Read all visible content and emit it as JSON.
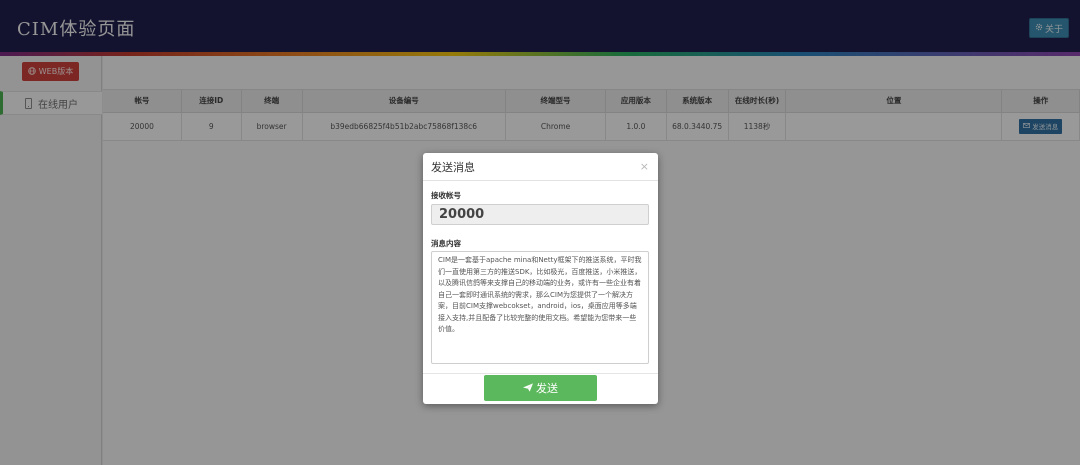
{
  "header": {
    "title": "CIM体验页面",
    "about_label": "关于",
    "about_icon": "gear-icon"
  },
  "sidebar": {
    "web_button": {
      "label": "WEB版本",
      "icon": "globe-icon"
    },
    "items": [
      {
        "label": "在线用户",
        "icon": "phone-icon",
        "active": true
      }
    ]
  },
  "table": {
    "columns": [
      "帐号",
      "连接ID",
      "终端",
      "设备编号",
      "终端型号",
      "应用版本",
      "系统版本",
      "在线时长(秒)",
      "位置",
      "操作"
    ],
    "rows": [
      {
        "account": "20000",
        "conn_id": "9",
        "terminal": "browser",
        "device_id": "b39edb66825f4b51b2abc75868f138c6",
        "model": "Chrome",
        "app_version": "1.0.0",
        "os_version": "68.0.3440.75",
        "online": "1138秒",
        "location": "",
        "action": "发送消息"
      }
    ]
  },
  "modal": {
    "title": "发送消息",
    "close": "×",
    "account_label": "接收帐号",
    "account_value": "20000",
    "message_label": "消息内容",
    "message_value": "CIM是一套基于apache mina和Netty框架下的推送系统，平时我们一直使用第三方的推送SDK，比如极光，百度推送，小米推送，以及腾讯信鸽等来支撑自己的移动端的业务，或许有一些企业有着自己一套即时通讯系统的需求，那么CIM为您提供了一个解决方案，目前CIM支撑webcokset，android，ios，桌面应用等多端接入支持,并且配备了比较完整的使用文档。希望能为您带来一些价值。",
    "send_label": "发送"
  },
  "colors": {
    "header_bg": "#1f1f4d",
    "about_btn": "#3e8bb0",
    "web_btn": "#c9403a",
    "active_marker": "#4caf50",
    "send_btn": "#5cb85c",
    "row_action_btn": "#2f6f9e"
  }
}
